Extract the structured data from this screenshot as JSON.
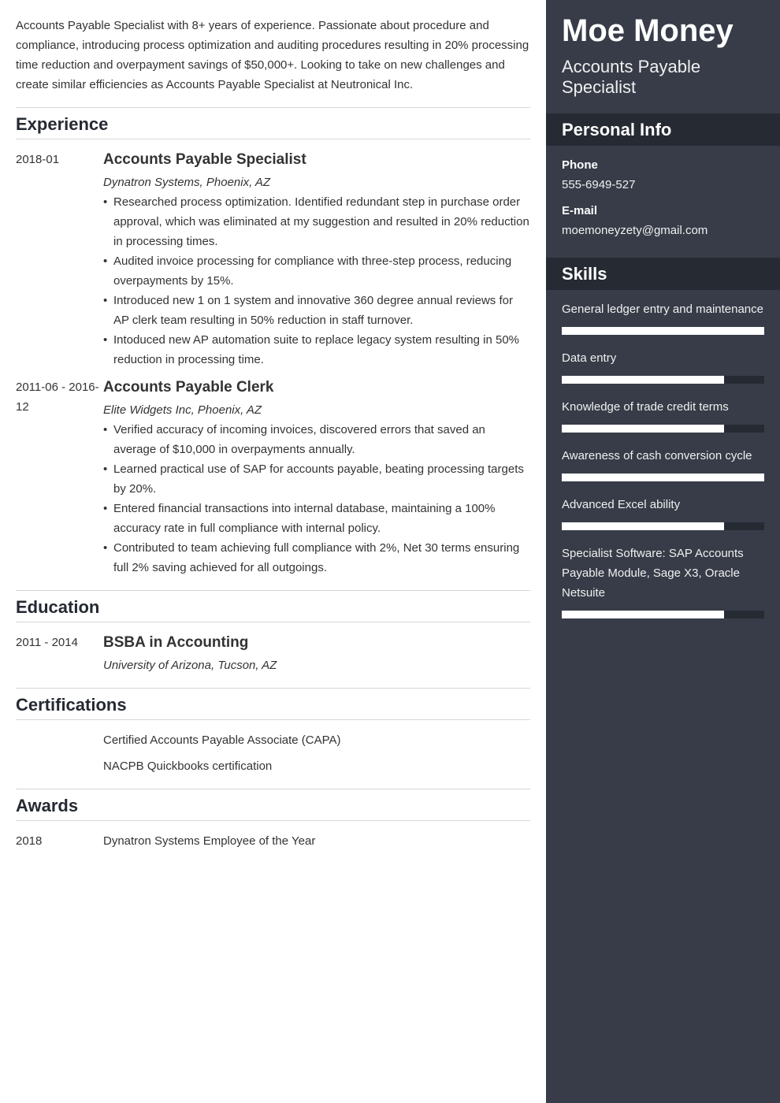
{
  "summary": "Accounts Payable Specialist with 8+ years of experience. Passionate about procedure and compliance, introducing process optimization and auditing procedures resulting in 20% processing time reduction and overpayment savings of $50,000+. Looking to take on new challenges and create similar efficiencies as Accounts Payable Specialist at Neutronical Inc.",
  "experience": {
    "title": "Experience",
    "entries": [
      {
        "date": "2018-01",
        "title": "Accounts Payable Specialist",
        "org": "Dynatron Systems, Phoenix, AZ",
        "bullets": [
          "Researched process optimization. Identified redundant step in purchase order approval, which was eliminated at my suggestion and resulted in 20% reduction in processing times.",
          "Audited invoice processing for compliance with three-step process, reducing overpayments by 15%.",
          "Introduced new 1 on 1 system and innovative 360 degree annual reviews for AP clerk team resulting in 50% reduction in staff turnover.",
          "Intoduced new AP automation suite to replace legacy system resulting in 50% reduction in processing time."
        ]
      },
      {
        "date": "2011-06 - 2016-12",
        "title": "Accounts Payable Clerk",
        "org": "Elite Widgets Inc, Phoenix, AZ",
        "bullets": [
          "Verified accuracy of incoming invoices, discovered errors that saved an average of $10,000 in overpayments annually.",
          "Learned practical use of SAP for accounts payable, beating processing targets by 20%.",
          "Entered financial transactions into internal database, maintaining a 100% accuracy rate in full compliance with internal policy.",
          "Contributed to team achieving full compliance with 2%, Net 30 terms ensuring full 2% saving achieved for all outgoings."
        ]
      }
    ]
  },
  "education": {
    "title": "Education",
    "entries": [
      {
        "date": "2011 - 2014",
        "title": "BSBA in Accounting",
        "org": "University of Arizona, Tucson, AZ"
      }
    ]
  },
  "certifications": {
    "title": "Certifications",
    "items": [
      "Certified Accounts Payable Associate (CAPA)",
      "NACPB Quickbooks certification"
    ]
  },
  "awards": {
    "title": "Awards",
    "items": [
      {
        "date": "2018",
        "text": "Dynatron Systems Employee of the Year"
      }
    ]
  },
  "sidebar": {
    "name": "Moe Money",
    "role": "Accounts Payable Specialist",
    "personal_info": {
      "title": "Personal Info",
      "phone_label": "Phone",
      "phone": "555-6949-527",
      "email_label": "E-mail",
      "email": "moemoneyzety@gmail.com"
    },
    "skills": {
      "title": "Skills",
      "items": [
        {
          "name": "General ledger entry and maintenance",
          "level": 1.0
        },
        {
          "name": "Data entry",
          "level": 0.8
        },
        {
          "name": "Knowledge of trade credit terms",
          "level": 0.8
        },
        {
          "name": "Awareness of cash conversion cycle",
          "level": 1.0
        },
        {
          "name": "Advanced Excel ability",
          "level": 0.8
        },
        {
          "name": "Specialist Software: SAP Accounts Payable Module, Sage X3, Oracle Netsuite",
          "level": 0.8
        }
      ]
    }
  }
}
